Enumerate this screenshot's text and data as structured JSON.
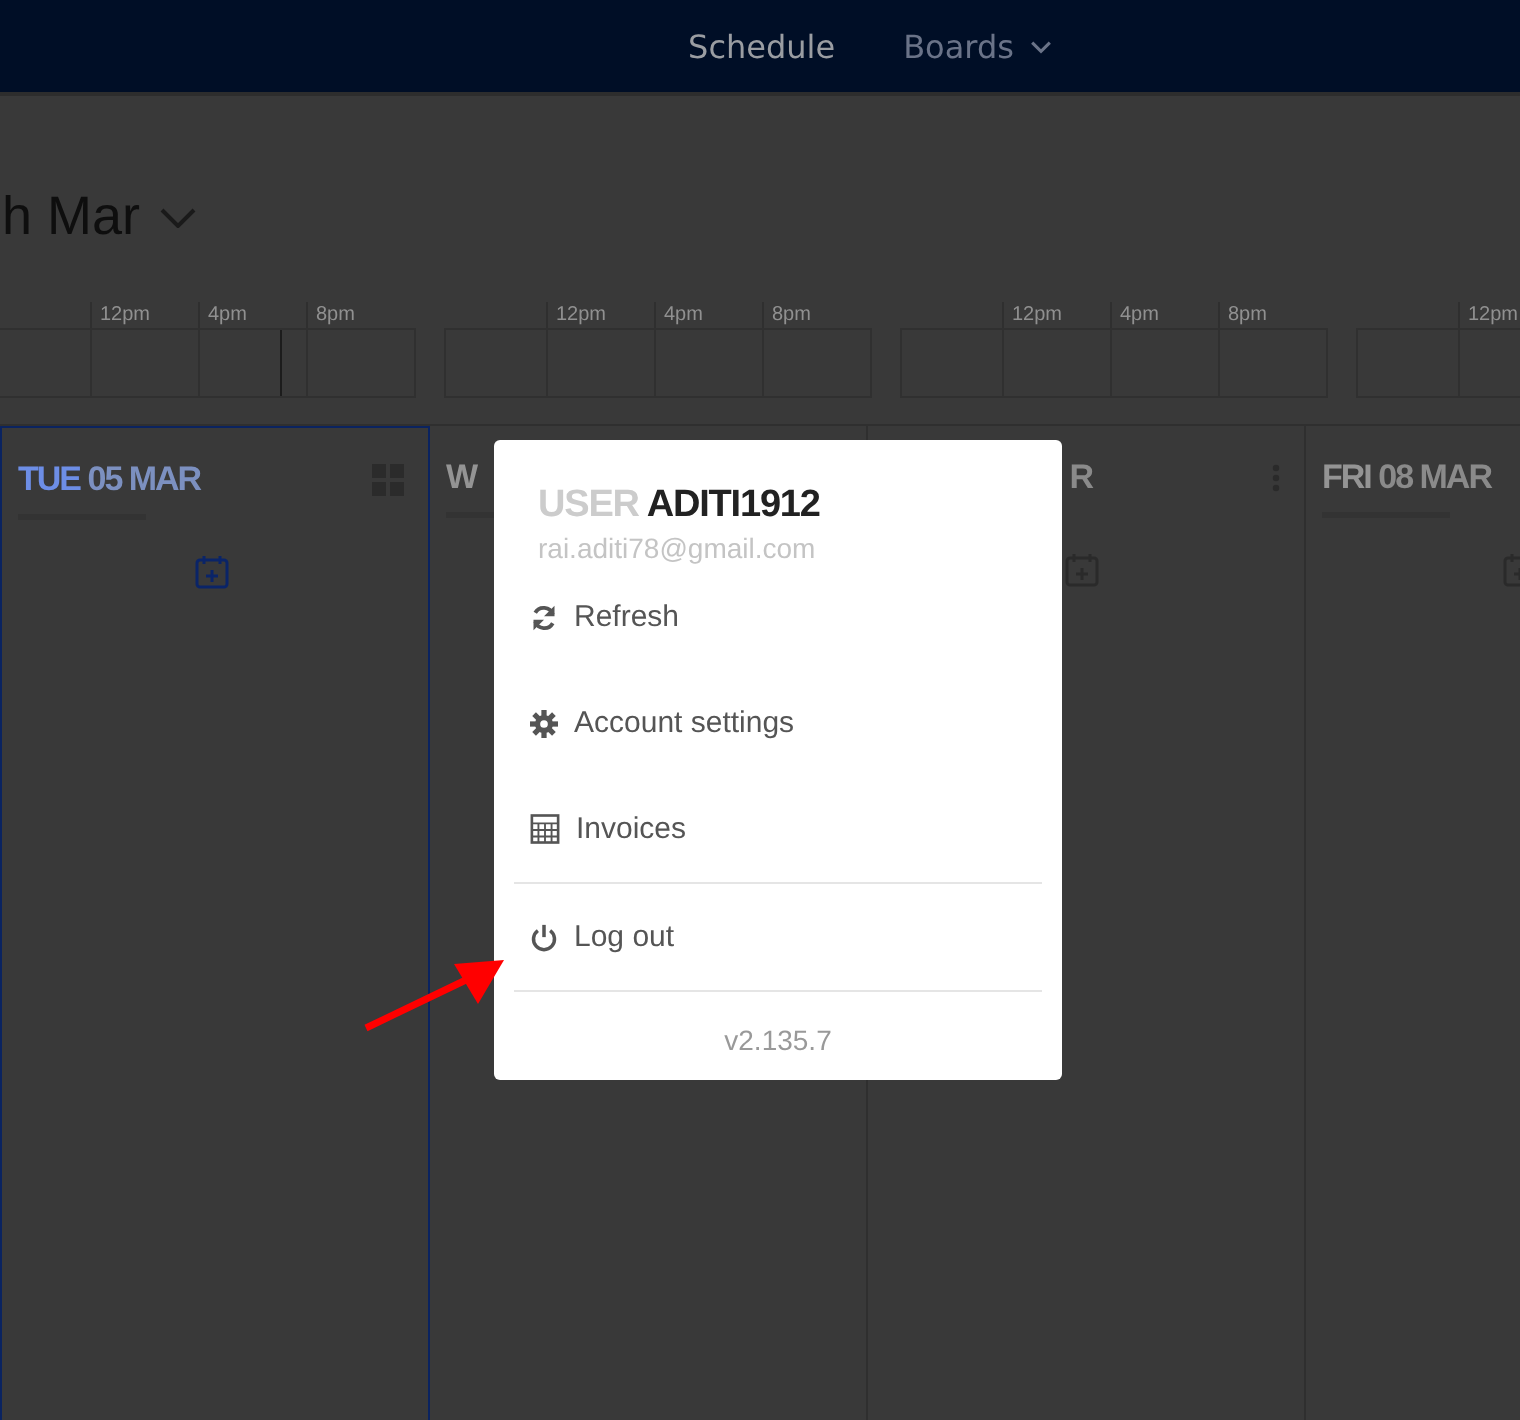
{
  "nav": [
    {
      "label": "Schedule",
      "selected": true
    },
    {
      "label": "Boards",
      "selected": false
    }
  ],
  "heading": {
    "text": "h Mar"
  },
  "timeline": [
    {
      "labels": [
        "12pm",
        "4pm",
        "8pm"
      ]
    },
    {
      "labels": [
        "12pm",
        "4pm",
        "8pm"
      ]
    },
    {
      "labels": [
        "12pm",
        "4pm",
        "8pm"
      ]
    },
    {
      "labels": [
        "12pm"
      ]
    }
  ],
  "days": [
    {
      "weekday": "TUE",
      "date": "05 MAR",
      "selected": true
    },
    {
      "weekday": "W",
      "selected": false
    },
    {
      "date": "R",
      "selected": false
    },
    {
      "weekday": "FRI",
      "date": "08 MAR",
      "selected": false
    }
  ],
  "user_menu": {
    "label": "USER",
    "username": "ADITI1912",
    "email": "rai.aditi78@gmail.com",
    "items": [
      {
        "label": "Refresh"
      },
      {
        "label": "Account settings"
      },
      {
        "label": "Invoices"
      },
      {
        "label": "Log out"
      }
    ],
    "version": "v2.135.7"
  }
}
